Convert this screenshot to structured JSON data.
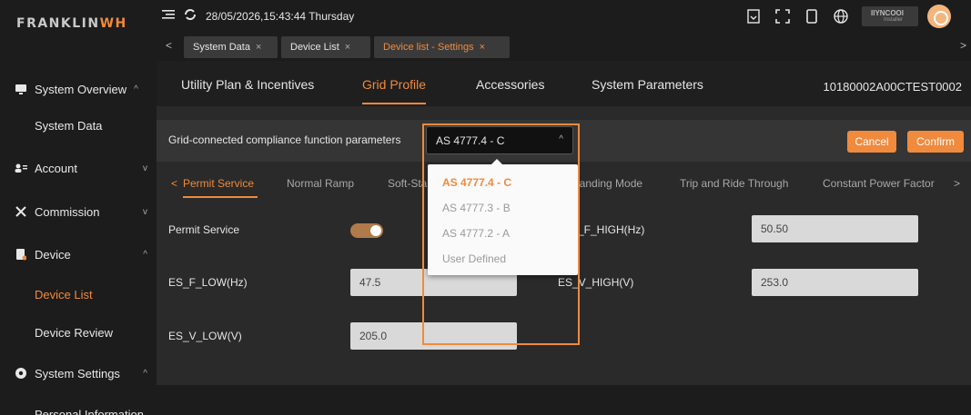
{
  "brand": {
    "name_part1": "FRANKLIN",
    "name_part2": "WH"
  },
  "sidebar": {
    "items": [
      {
        "label": "System Overview",
        "icon": "monitor-icon",
        "chevron": "^"
      },
      {
        "label": "System Data"
      },
      {
        "label": "Account",
        "icon": "account-icon",
        "chevron": "v"
      },
      {
        "label": "Commission",
        "icon": "tools-icon",
        "chevron": "v"
      },
      {
        "label": "Device",
        "icon": "device-icon",
        "chevron": "^"
      },
      {
        "label": "Device List"
      },
      {
        "label": "Device Review"
      },
      {
        "label": "System Settings",
        "icon": "gear-icon",
        "chevron": "^"
      },
      {
        "label": "Personal Information"
      }
    ]
  },
  "topbar": {
    "datetime": "28/05/2026,15:43:44 Thursday"
  },
  "badge": {
    "line1": "IIYNCOOI",
    "line2": "Installer"
  },
  "open_tabs": [
    {
      "label": "System Data"
    },
    {
      "label": "Device List"
    },
    {
      "label": "Device list - Settings"
    }
  ],
  "subnav": {
    "items": [
      "Utility Plan & Incentives",
      "Grid Profile",
      "Accessories",
      "System Parameters"
    ],
    "serial": "10180002A00CTEST0002"
  },
  "param_row": {
    "label": "Grid-connected compliance function parameters",
    "selected": "AS 4777.4 - C",
    "cancel": "Cancel",
    "confirm": "Confirm"
  },
  "sub_tabs": [
    "Permit Service",
    "Normal Ramp",
    "Soft-Sta",
    "landing Mode",
    "Trip and Ride Through",
    "Constant Power Factor"
  ],
  "fields": {
    "permit_service_label": "Permit Service",
    "permit_service_on": true,
    "es_f_high_label": "_F_HIGH(Hz)",
    "es_f_high_value": "50.50",
    "es_f_low_label": "ES_F_LOW(Hz)",
    "es_f_low_value": "47.5",
    "es_v_high_label": "ES_V_HIGH(V)",
    "es_v_high_value": "253.0",
    "es_v_low_label": "ES_V_LOW(V)",
    "es_v_low_value": "205.0"
  },
  "dropdown": {
    "options": [
      "AS 4777.4 - C",
      "AS 4777.3 - B",
      "AS 4777.2 - A",
      "User Defined"
    ]
  },
  "colors": {
    "accent": "#f08a3c",
    "background": "#2a2a2a",
    "sidebar": "#1c1c1c"
  }
}
